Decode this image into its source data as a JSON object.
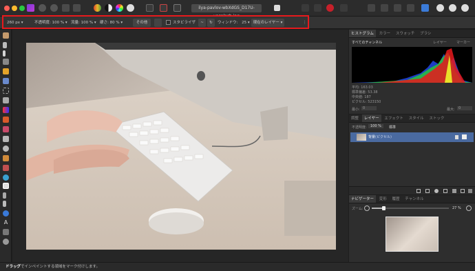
{
  "document": {
    "filename": "ilya-pavlov-wbXdGS_D17U-unsplash.jpg"
  },
  "context_toolbar": {
    "width_value": "260 px",
    "opacity_label": "不透明度:",
    "opacity_value": "100 %",
    "flow_label": "流量:",
    "flow_value": "100 %",
    "hardness_label": "硬さ:",
    "hardness_value": "80 %",
    "more_button": "その他",
    "stabilizer_label": "スタビライザ",
    "window_label": "ウィンドウ:",
    "window_value": "25",
    "layer_select": "現在のレイヤー"
  },
  "histogram_panel": {
    "tabs": [
      "ヒストグラム",
      "カラー",
      "スウォッチ",
      "ブラシ"
    ],
    "channel_select": "すべてのチャンネル",
    "layer_label": "レイヤー",
    "marker_label": "マーカー",
    "stats": [
      {
        "label": "平均:",
        "value": "163.03"
      },
      {
        "label": "標準偏差:",
        "value": "53.38"
      },
      {
        "label": "中央値:",
        "value": "187"
      },
      {
        "label": "ピクセル:",
        "value": "523150"
      }
    ],
    "min_label": "最小:",
    "min_value": "0",
    "max_label": "最大:",
    "max_value": "0"
  },
  "layers_panel": {
    "tabs": [
      "調整",
      "レイヤー",
      "エフェクト",
      "スタイル",
      "ストック"
    ],
    "opacity_label": "不透明度:",
    "opacity_value": "100 %",
    "blend_mode": "標準",
    "layer_name": "背景",
    "layer_type": "(ピクセル)"
  },
  "navigator_panel": {
    "tabs": [
      "ナビゲーター",
      "変形",
      "履歴",
      "チャンネル"
    ],
    "zoom_label": "ズーム:",
    "zoom_value": "27 %"
  },
  "statusbar": {
    "drag_label": "ドラッグ",
    "message": "でインペイントする領域をマーク付けします。"
  },
  "colors": {
    "highlight": "#e8191c",
    "selected_layer": "#4a6aa0",
    "accent_blue": "#3b7bd8"
  }
}
